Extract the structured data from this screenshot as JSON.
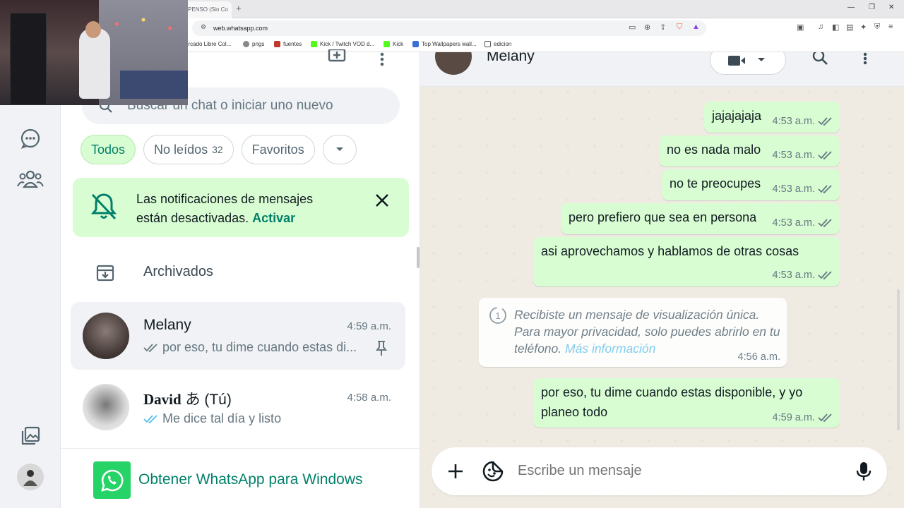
{
  "browser": {
    "tab_title": "PENSO (Sin Co",
    "url": "web.whatsapp.com",
    "bookmarks": [
      {
        "label": "ercado Libre Col...",
        "color": "#f5d000"
      },
      {
        "label": "pngs",
        "color": "#888888"
      },
      {
        "label": "fuentes",
        "color": "#c0392b"
      },
      {
        "label": "Kick / Twitch VOD d...",
        "color": "#111111"
      },
      {
        "label": "Kick",
        "color": "#53fc18"
      },
      {
        "label": "Top Wallpapers wall...",
        "color": "#3a6fd8"
      },
      {
        "label": "edicion",
        "color": "#ffffff"
      }
    ]
  },
  "sidebar": {
    "search_placeholder": "Buscar un chat o iniciar uno nuevo",
    "filters": [
      {
        "label": "Todos",
        "active": true
      },
      {
        "label": "No leídos",
        "count": "32"
      },
      {
        "label": "Favoritos"
      }
    ],
    "notification": {
      "line1": "Las notificaciones de mensajes",
      "line2_prefix": "están desactivadas.",
      "action": "Activar"
    },
    "archived_label": "Archivados",
    "chats": [
      {
        "name": "Melany",
        "time": "4:59 a.m.",
        "preview": "por eso, tu dime cuando estas di...",
        "ticks": "read-grey",
        "pinned": true
      },
      {
        "name_bold": "David",
        "name_suffix": "あ (Tú)",
        "time": "4:58 a.m.",
        "preview": "Me dice tal día y listo",
        "ticks": "read-blue"
      }
    ],
    "get_app_label": "Obtener WhatsApp para Windows"
  },
  "conversation": {
    "contact_name": "Melany",
    "messages": [
      {
        "text": "jajajajaja",
        "time": "4:53 a.m."
      },
      {
        "text": "no es nada malo",
        "time": "4:53 a.m."
      },
      {
        "text": "no te preocupes",
        "time": "4:53 a.m."
      },
      {
        "text": "pero prefiero que sea en persona",
        "time": "4:53 a.m."
      },
      {
        "text": "asi aprovechamos y hablamos de otras cosas",
        "time": "4:53 a.m."
      },
      {
        "text_line1": "por eso, tu dime cuando estas disponible, y yo",
        "text_line2": "planeo todo",
        "time": "4:59 a.m."
      }
    ],
    "view_once": {
      "text1": "Recibiste un mensaje de visualización única.",
      "text2": "Para mayor privacidad, solo puedes abrirlo en tu",
      "text3": "teléfono.",
      "link": "Más información",
      "time": "4:56 a.m."
    },
    "composer_placeholder": "Escribe un mensaje"
  },
  "colors": {
    "accent": "#008069",
    "bubble_out": "#d9fdd3",
    "chat_bg": "#efeae2",
    "read_blue": "#53bdeb"
  }
}
